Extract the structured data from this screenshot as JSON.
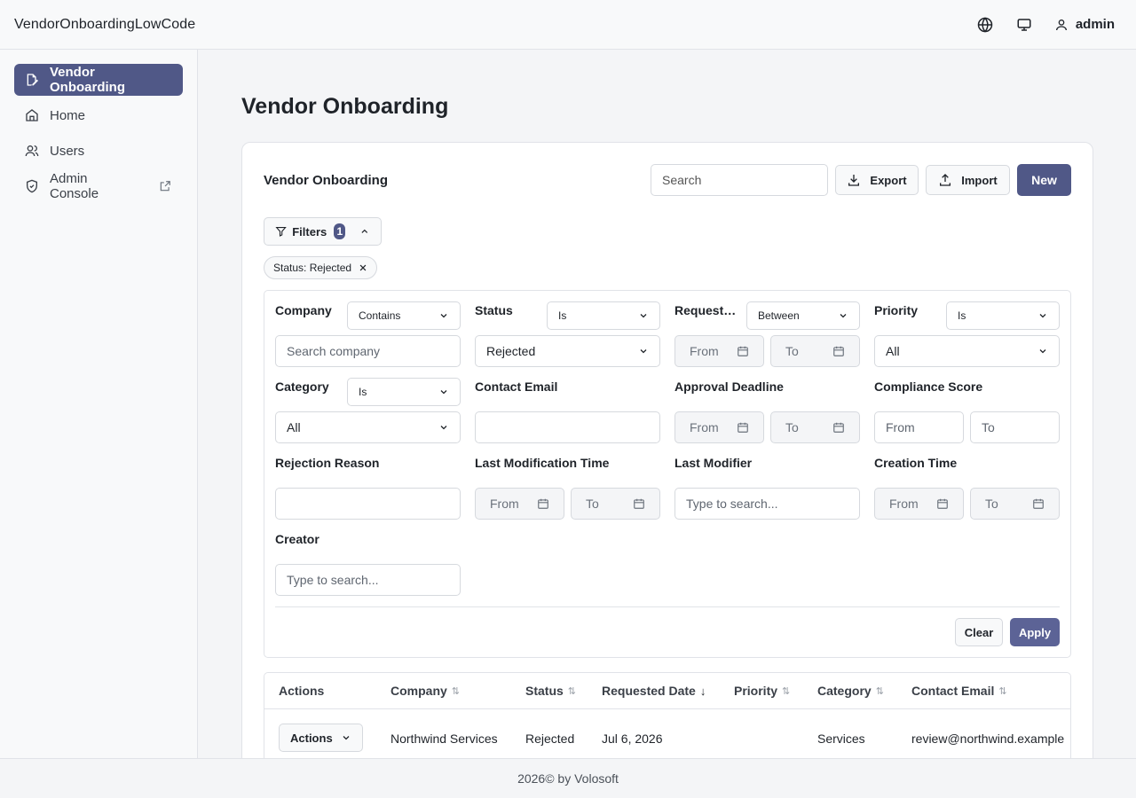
{
  "app": {
    "title": "VendorOnboardingLowCode",
    "user": "admin"
  },
  "sidebar": {
    "items": [
      {
        "label": "Vendor Onboarding",
        "active": true
      },
      {
        "label": "Home"
      },
      {
        "label": "Users"
      },
      {
        "label": "Admin Console"
      }
    ]
  },
  "page": {
    "title": "Vendor Onboarding"
  },
  "card": {
    "title": "Vendor Onboarding",
    "search_placeholder": "Search",
    "export_label": "Export",
    "import_label": "Import",
    "new_label": "New"
  },
  "filters": {
    "button_label": "Filters",
    "count": "1",
    "active_chip": "Status: Rejected",
    "company": {
      "label": "Company",
      "operator": "Contains",
      "placeholder": "Search company"
    },
    "status": {
      "label": "Status",
      "operator": "Is",
      "value": "Rejected"
    },
    "requested_date": {
      "label": "Requested Date",
      "label_display": "Requeste...",
      "operator": "Between",
      "from": "From",
      "to": "To"
    },
    "priority": {
      "label": "Priority",
      "operator": "Is",
      "value": "All"
    },
    "category": {
      "label": "Category",
      "operator": "Is",
      "value": "All"
    },
    "contact_email": {
      "label": "Contact Email"
    },
    "approval_deadline": {
      "label": "Approval Deadline",
      "from": "From",
      "to": "To"
    },
    "compliance_score": {
      "label": "Compliance Score",
      "from": "From",
      "to": "To"
    },
    "rejection_reason": {
      "label": "Rejection Reason"
    },
    "last_modification_time": {
      "label": "Last Modification Time",
      "from": "From",
      "to": "To"
    },
    "last_modifier": {
      "label": "Last Modifier",
      "placeholder": "Type to search..."
    },
    "creation_time": {
      "label": "Creation Time",
      "from": "From",
      "to": "To"
    },
    "creator": {
      "label": "Creator",
      "placeholder": "Type to search..."
    },
    "clear_label": "Clear",
    "apply_label": "Apply"
  },
  "table": {
    "columns": [
      "Actions",
      "Company",
      "Status",
      "Requested Date",
      "Priority",
      "Category",
      "Contact Email"
    ],
    "rows": [
      {
        "actions": "Actions",
        "company": "Northwind Services",
        "status": "Rejected",
        "requested_date": "Jul 6, 2026",
        "priority": "",
        "category": "Services",
        "contact_email": "review@northwind.example"
      }
    ]
  },
  "footer": {
    "text": "2026© by Volosoft"
  },
  "colors": {
    "accent": "#505887",
    "apply": "#5c6396"
  }
}
